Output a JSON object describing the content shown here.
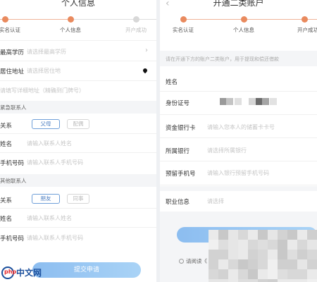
{
  "left": {
    "title": "个人信息",
    "steps": [
      {
        "label": "实名认证",
        "active": true
      },
      {
        "label": "个人信息",
        "active": true
      },
      {
        "label": "开户成功",
        "active": false
      }
    ],
    "rows": {
      "education": {
        "label": "最高学历",
        "placeholder": "请选择最高学历"
      },
      "address": {
        "label": "居住地址",
        "placeholder": "请选择居住地"
      },
      "detail": {
        "placeholder": "请填写详细地址（精确到门牌号）"
      }
    },
    "contact1": {
      "section": "紧急联系人",
      "relation_label": "关系",
      "options": [
        "父母",
        "配偶"
      ],
      "selected": "父母",
      "name_label": "姓名",
      "name_placeholder": "请输入联系人姓名",
      "phone_label": "手机号码",
      "phone_placeholder": "请输入联系人手机号码"
    },
    "contact2": {
      "section": "其他联系人",
      "relation_label": "关系",
      "options": [
        "朋友",
        "同事"
      ],
      "selected": "朋友",
      "name_label": "姓名",
      "name_placeholder": "请输入联系人姓名",
      "phone_label": "手机号码",
      "phone_placeholder": "请输入联系人手机号码"
    },
    "submit": "提交申请",
    "logo": {
      "mark": "php",
      "text": "中文网"
    }
  },
  "right": {
    "title": "开通二类账户",
    "steps": [
      {
        "label": "实名认证",
        "active": true
      },
      {
        "label": "个人信息",
        "active": true
      },
      {
        "label": "开户成功",
        "active": true
      }
    ],
    "notice": "请在开通下方的账户二类账户，用于提现和偿还借款",
    "name_label": "姓名",
    "id_label": "身份证号",
    "card": {
      "label": "资金银行卡",
      "placeholder": "请输入您本人的储蓄卡卡号"
    },
    "bank": {
      "label": "所属银行",
      "placeholder": "请选择所属银行"
    },
    "phone": {
      "label": "预留手机号",
      "placeholder": "请输入银行预留手机号码"
    },
    "job": {
      "label": "职业信息",
      "placeholder": "请选择"
    },
    "agree": "请阅读《"
  },
  "colors": {
    "accent": "#e98a5e",
    "button": "#8cbdf0",
    "chip_active": "#4a7cc0"
  }
}
